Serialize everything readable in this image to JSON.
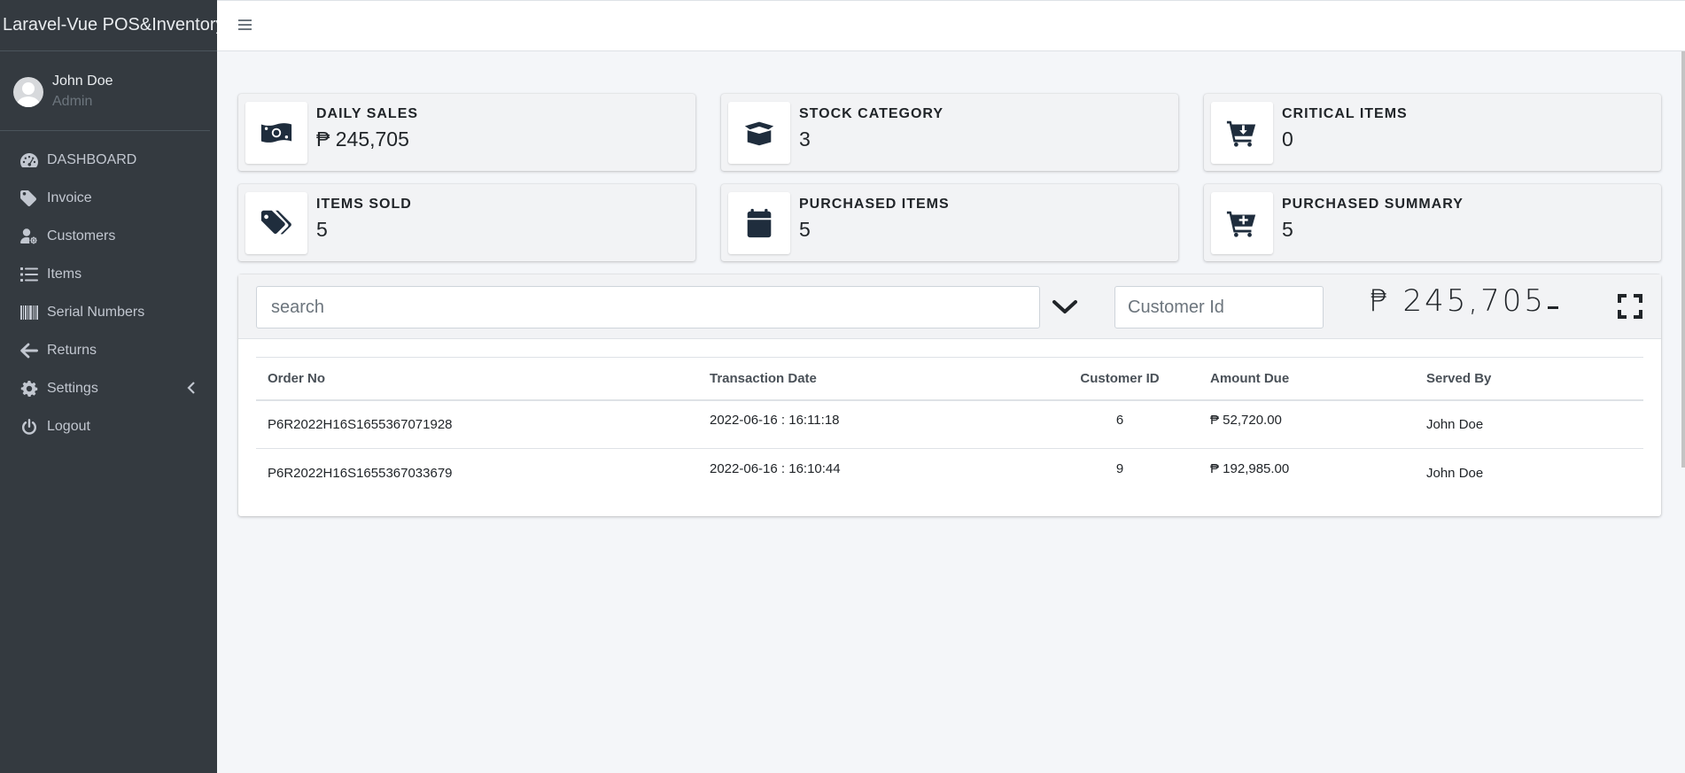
{
  "sidebar": {
    "brand": "Laravel-Vue POS&Inventory",
    "user": {
      "name": "John Doe",
      "role": "Admin"
    },
    "items": [
      {
        "label": "DASHBOARD",
        "icon": "gauge-icon"
      },
      {
        "label": "Invoice",
        "icon": "tag-icon"
      },
      {
        "label": "Customers",
        "icon": "user-cog-icon"
      },
      {
        "label": "Items",
        "icon": "list-icon"
      },
      {
        "label": "Serial Numbers",
        "icon": "barcode-icon"
      },
      {
        "label": "Returns",
        "icon": "arrow-left-icon"
      },
      {
        "label": "Settings",
        "icon": "gear-icon"
      },
      {
        "label": "Logout",
        "icon": "power-icon"
      }
    ]
  },
  "boxes": [
    {
      "label": "DAILY SALES",
      "value": "₱ 245,705",
      "icon": "money-icon"
    },
    {
      "label": "STOCK CATEGORY",
      "value": "3",
      "icon": "box-open-icon"
    },
    {
      "label": "CRITICAL ITEMS",
      "value": "0",
      "icon": "cart-arrow-down-icon"
    },
    {
      "label": "ITEMS SOLD",
      "value": "5",
      "icon": "tags-icon"
    },
    {
      "label": "PURCHASED ITEMS",
      "value": "5",
      "icon": "calendar-icon"
    },
    {
      "label": "PURCHASED SUMMARY",
      "value": "5",
      "icon": "cart-plus-icon"
    }
  ],
  "toolbar": {
    "search_placeholder": "search",
    "customer_placeholder": "Customer Id",
    "total": "₱ 245,705"
  },
  "table": {
    "headers": [
      "Order No",
      "Transaction Date",
      "Customer ID",
      "Amount Due",
      "Served By"
    ],
    "rows": [
      [
        "P6R2022H16S1655367071928",
        "2022-06-16 : 16:11:18",
        "6",
        "₱ 52,720.00",
        "John Doe"
      ],
      [
        "P6R2022H16S1655367033679",
        "2022-06-16 : 16:10:44",
        "9",
        "₱ 192,985.00",
        "John Doe"
      ]
    ]
  },
  "colors": {
    "sidebar_bg": "#343a40",
    "content_bg": "#f4f6f9",
    "icon_dark": "#1f2d3d"
  }
}
